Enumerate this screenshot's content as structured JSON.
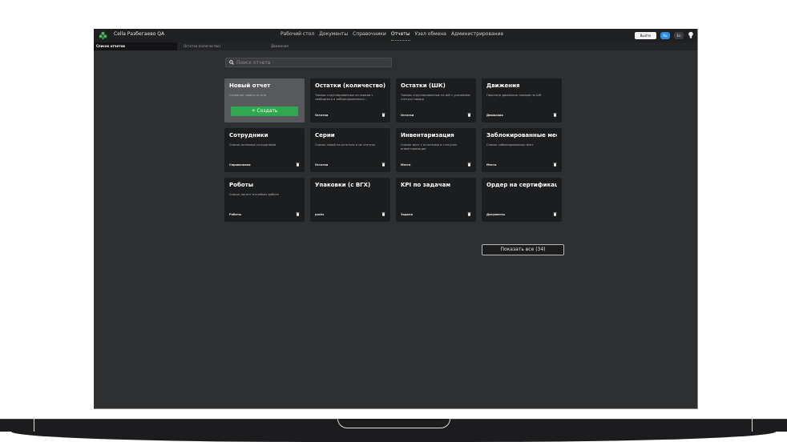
{
  "app": {
    "title": "Cella Разбегаево QA"
  },
  "nav": {
    "items": [
      {
        "label": "Рабочий стол",
        "active": false
      },
      {
        "label": "Документы",
        "active": false
      },
      {
        "label": "Справочники",
        "active": false
      },
      {
        "label": "Отчеты",
        "active": true
      },
      {
        "label": "Узел обмена",
        "active": false
      },
      {
        "label": "Администрирование",
        "active": false
      }
    ],
    "exit_label": "Выйти",
    "lang_ru": "Ru",
    "lang_en": "En"
  },
  "tabs": [
    {
      "label": "Список отчетов",
      "active": true
    },
    {
      "label": "Остатки (количество)",
      "active": false
    },
    {
      "label": "Движения",
      "active": false
    }
  ],
  "search": {
    "placeholder": "Поиск отчета",
    "value": ""
  },
  "new_report": {
    "title": "Новый отчет",
    "desc": "Создание нового отчета",
    "button": "+ Создать"
  },
  "reports": [
    {
      "title": "Остатки (количество)",
      "desc": "Товары сгруппированные по сериям с свободного и заблокированного...",
      "tag": "Остатки"
    },
    {
      "title": "Остатки (ШК)",
      "desc": "Товары сгруппированные по ШК с указанием статуса товара",
      "tag": "Остатки"
    },
    {
      "title": "Движения",
      "desc": "Просмотр движения товаров по ШК",
      "tag": "Движения"
    },
    {
      "title": "Сотрудники",
      "desc": "Список активных сотрудников",
      "tag": "Справочники"
    },
    {
      "title": "Серии",
      "desc": "Список серий на остатках и их статусы",
      "tag": "Остатки"
    },
    {
      "title": "Инвентаризация",
      "desc": "Список мест с остатками и статусом инвентаризации",
      "tag": "Места"
    },
    {
      "title": "Заблокированные мест",
      "desc": "Список заблокированных мест",
      "tag": "Места"
    },
    {
      "title": "Роботы",
      "desc": "Список нагент в ячейках роботе",
      "tag": "Роботы"
    },
    {
      "title": "Упаковки (с ВГХ)",
      "desc": "",
      "tag": "packs"
    },
    {
      "title": "KPI по задачам",
      "desc": "",
      "tag": "Задачи"
    },
    {
      "title": "Ордер на сертификацию",
      "desc": "",
      "tag": "Документы"
    }
  ],
  "show_all_label": "Показать все (34)",
  "colors": {
    "accent": "#2fa84f",
    "background": "#2e2f31",
    "card": "#1c1d1f",
    "lang_active": "#2d8fe0"
  }
}
